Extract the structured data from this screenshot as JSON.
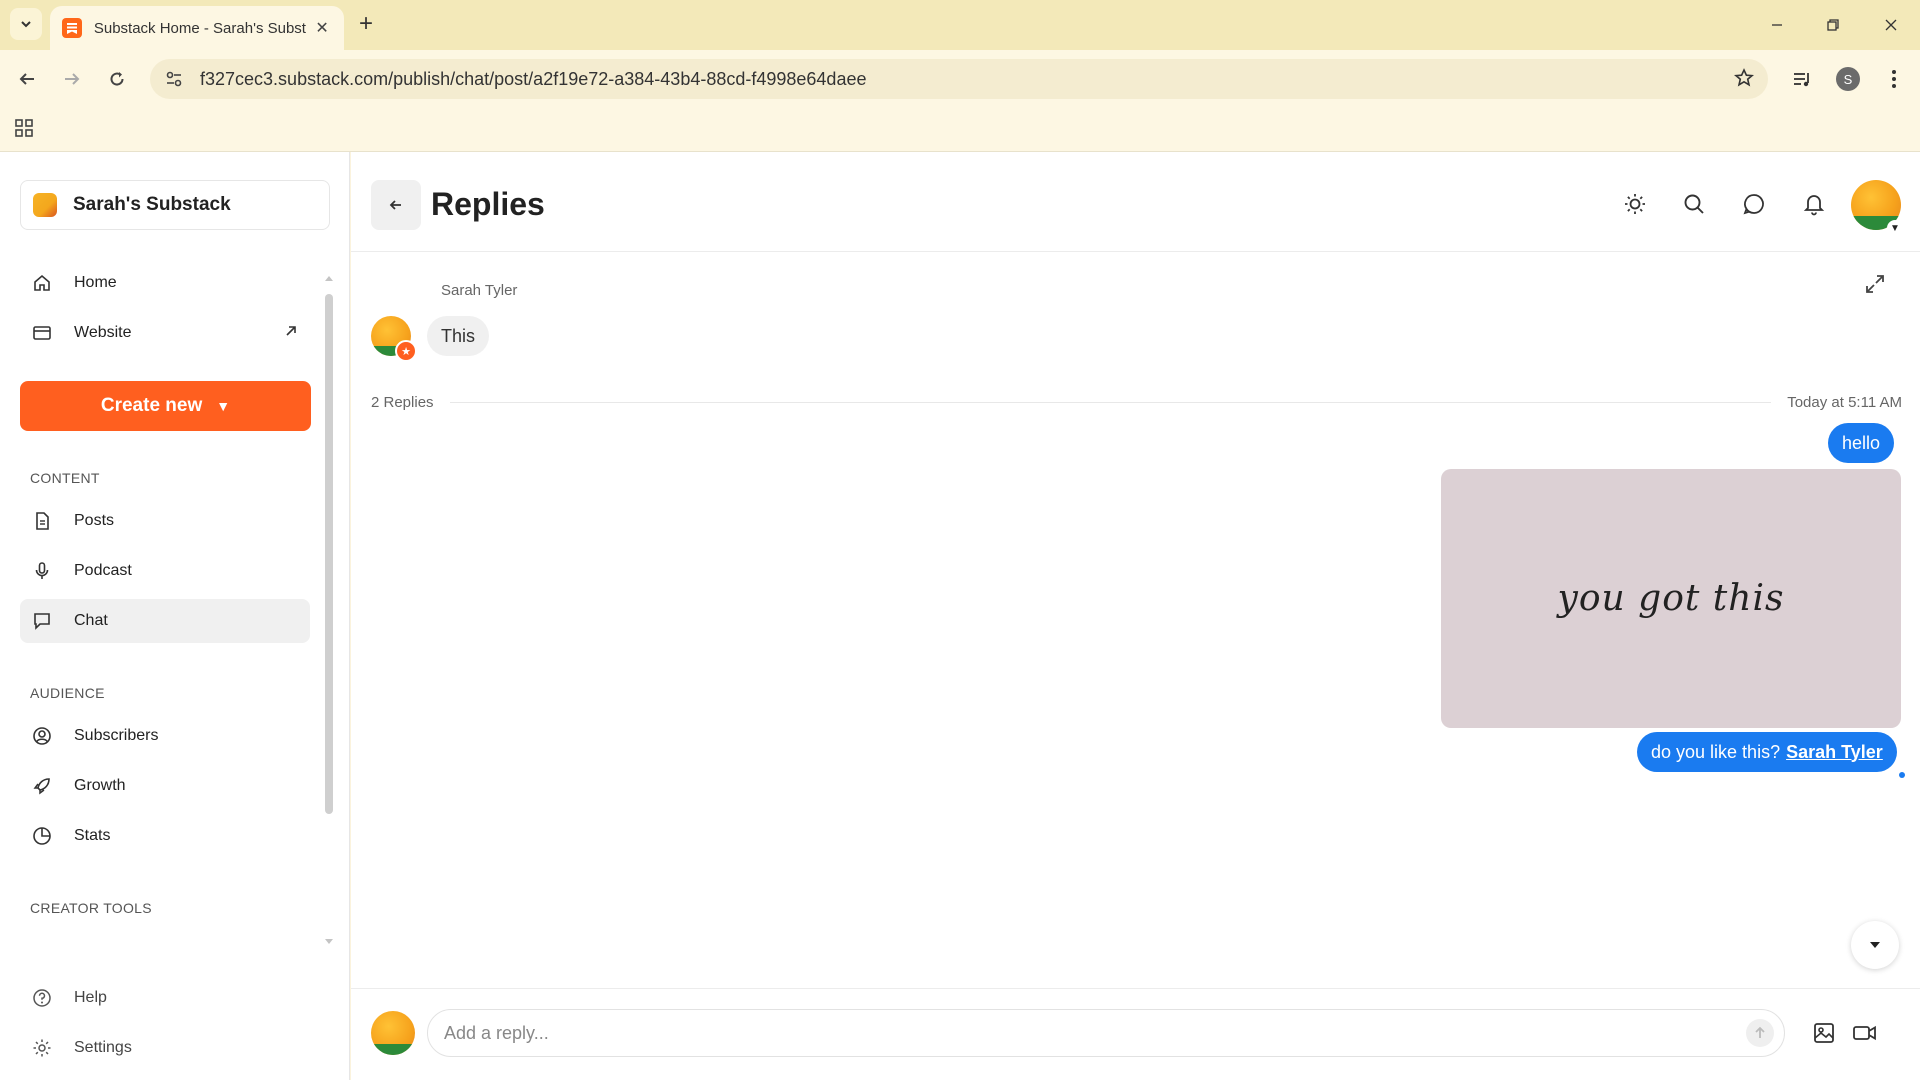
{
  "browser": {
    "tab_title": "Substack Home - Sarah's Subst",
    "url": "f327cec3.substack.com/publish/chat/post/a2f19e72-a384-43b4-88cd-f4998e64daee",
    "profile_initial": "S"
  },
  "sidebar": {
    "publication_name": "Sarah's Substack",
    "home_label": "Home",
    "website_label": "Website",
    "create_label": "Create new",
    "content_heading": "CONTENT",
    "content_items": [
      "Posts",
      "Podcast",
      "Chat"
    ],
    "audience_heading": "AUDIENCE",
    "audience_items": [
      "Subscribers",
      "Growth",
      "Stats"
    ],
    "creator_heading": "CREATOR TOOLS",
    "help_label": "Help",
    "settings_label": "Settings",
    "active_item": "Chat"
  },
  "main": {
    "title": "Replies",
    "parent_author": "Sarah Tyler",
    "parent_message": "This",
    "replies_count": "2 Replies",
    "replies_time": "Today at 5:11 AM",
    "messages": {
      "first": "hello",
      "image_text": "you got this",
      "third_text": "do you like this?",
      "third_mention": "Sarah Tyler"
    },
    "composer_placeholder": "Add a reply..."
  },
  "colors": {
    "accent": "#ff5f1f",
    "bubble_blue": "#1a7bf0",
    "chrome_bg": "#f3e9b9"
  }
}
